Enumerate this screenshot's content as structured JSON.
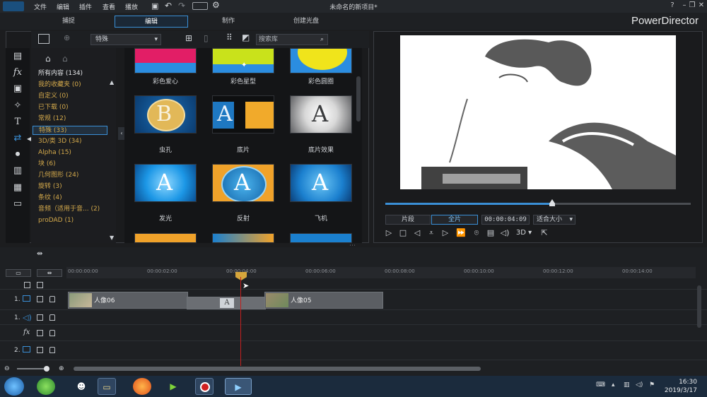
{
  "window": {
    "title": "未命名的新项目*",
    "menu": [
      "文件",
      "编辑",
      "插件",
      "查看",
      "播放"
    ],
    "help": "?",
    "brand": "PowerDirector"
  },
  "modes": [
    "捕捉",
    "编辑",
    "制作",
    "创建光盘"
  ],
  "library": {
    "dropdown": "特殊",
    "search_placeholder": "搜索库",
    "categories": [
      {
        "label": "所有内容 (134)"
      },
      {
        "label": "我的收藏夹 (0)"
      },
      {
        "label": "自定义 (0)"
      },
      {
        "label": "已下载 (0)"
      },
      {
        "label": "常规 (12)"
      },
      {
        "label": "特殊 (33)"
      },
      {
        "label": "3D/类 3D (34)"
      },
      {
        "label": "Alpha (15)"
      },
      {
        "label": "块 (6)"
      },
      {
        "label": "几何图形 (24)"
      },
      {
        "label": "旋转 (3)"
      },
      {
        "label": "条纹 (4)"
      },
      {
        "label": "音频（适用于音... (2)"
      },
      {
        "label": "proDAD (1)"
      }
    ],
    "transitions": [
      {
        "label": "彩色爱心"
      },
      {
        "label": "彩色星型"
      },
      {
        "label": "彩色圆圈"
      },
      {
        "label": "虫孔"
      },
      {
        "label": "底片"
      },
      {
        "label": "底片效果"
      },
      {
        "label": "发光"
      },
      {
        "label": "反射"
      },
      {
        "label": "飞机"
      }
    ],
    "thumb_letters": {
      "wormhole": "B",
      "film": "A",
      "negative": "A",
      "glow": "A",
      "reflect": "A",
      "plane": "A"
    }
  },
  "preview": {
    "clip_button": "片段",
    "full_button": "全片",
    "timecode": "00:00:04:09",
    "fit": "适合大小",
    "mode3d": "3D",
    "progress": 0.54
  },
  "timeline": {
    "ticks": [
      "00:00:00:00",
      "00:00:02:00",
      "00:00:04:00",
      "00:00:06:00",
      "00:00:08:00",
      "00:00:10:00",
      "00:00:12:00",
      "00:00:14:00"
    ],
    "tracks": [
      {
        "label": "1."
      },
      {
        "label": "1."
      },
      {
        "label": "fx"
      },
      {
        "label": "2."
      }
    ],
    "clips": [
      {
        "label": "人像06"
      },
      {
        "label": "A"
      },
      {
        "label": "人像05"
      }
    ]
  },
  "taskbar": {
    "time": "16:30",
    "date": "2019/3/17"
  },
  "colors": {
    "accent": "#3a8fd6",
    "category_text": "#d3a94b",
    "playhead": "#c4201f"
  }
}
